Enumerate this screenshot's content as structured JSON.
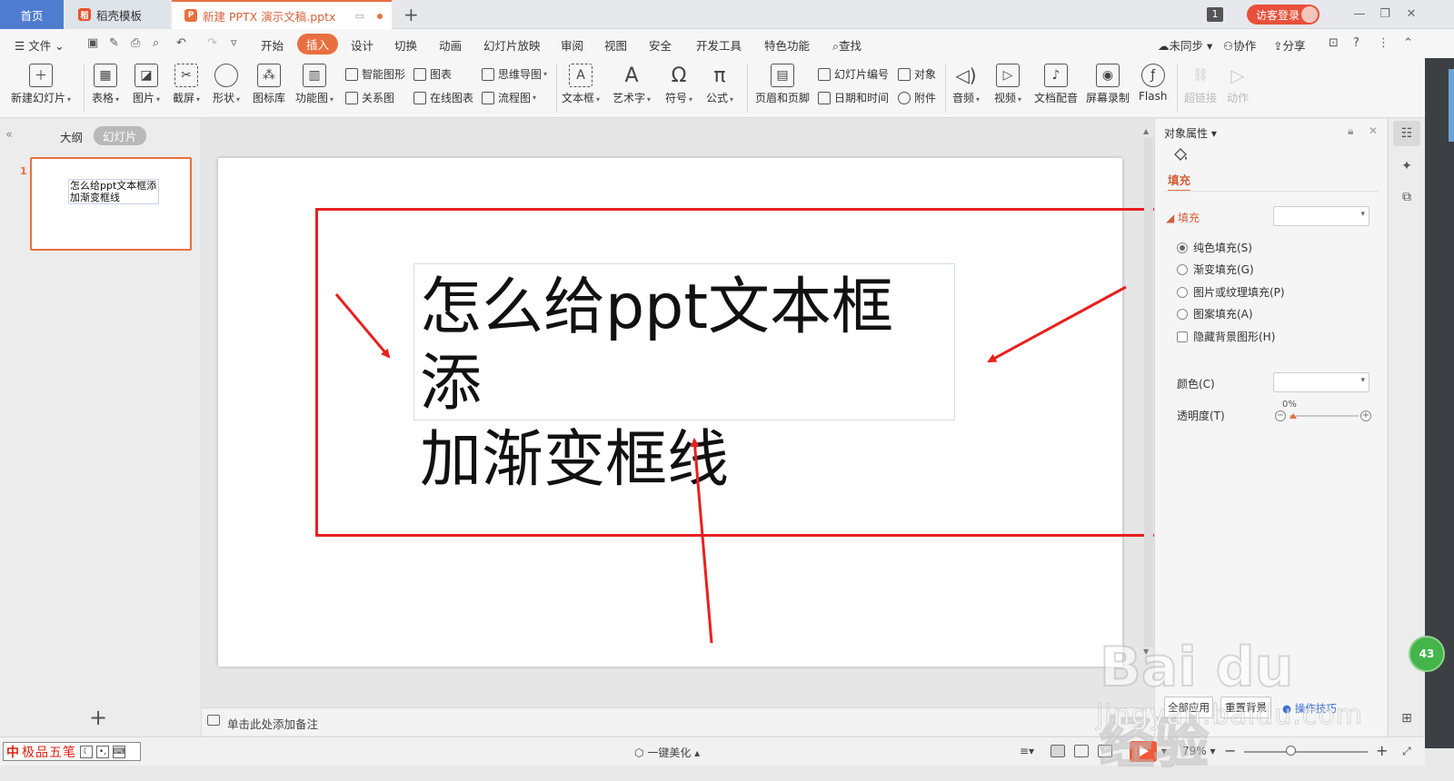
{
  "tabs": {
    "home": "首页",
    "template": "稻壳模板",
    "document": "新建 PPTX 演示文稿.pptx",
    "new_tab": "+"
  },
  "titlebar": {
    "window_count": "1",
    "login": "访客登录"
  },
  "menu": {
    "file": "文件",
    "items": [
      "开始",
      "插入",
      "设计",
      "切换",
      "动画",
      "幻灯片放映",
      "审阅",
      "视图",
      "安全",
      "开发工具",
      "特色功能"
    ],
    "active": "插入",
    "search": "查找",
    "sync": "未同步",
    "collab": "协作",
    "share": "分享"
  },
  "ribbon": {
    "new_slide": "新建幻灯片",
    "table": "表格",
    "picture": "图片",
    "screenshot": "截屏",
    "shape": "形状",
    "icon_lib": "图标库",
    "func_chart": "功能图",
    "smart_art": "智能图形",
    "chart": "图表",
    "mind_map": "思维导图",
    "relation": "关系图",
    "online_chart": "在线图表",
    "flowchart": "流程图",
    "textbox": "文本框",
    "art_text": "艺术字",
    "symbol": "符号",
    "formula": "公式",
    "header_footer": "页眉和页脚",
    "slide_number": "幻灯片编号",
    "object": "对象",
    "date_time": "日期和时间",
    "attachment": "附件",
    "audio": "音频",
    "video": "视频",
    "doc_voice": "文档配音",
    "screen_record": "屏幕录制",
    "flash": "Flash",
    "hyperlink": "超链接",
    "action": "动作"
  },
  "left_panel": {
    "outline_tab": "大纲",
    "slides_tab": "幻灯片",
    "slide_number": "1",
    "thumb_text": "怎么给ppt文本框添加渐变框线"
  },
  "slide": {
    "text_line1": "怎么给ppt文本框添",
    "text_line2": "加渐变框线"
  },
  "notes": {
    "placeholder": "单击此处添加备注"
  },
  "right_panel": {
    "title": "对象属性",
    "fill_tab": "填充",
    "fill_section": "填充",
    "options": [
      "纯色填充(S)",
      "渐变填充(G)",
      "图片或纹理填充(P)",
      "图案填充(A)"
    ],
    "selected_option": "纯色填充(S)",
    "hide_bg": "隐藏背景图形(H)",
    "color_label": "颜色(C)",
    "transparency_label": "透明度(T)",
    "transparency_value": "0%",
    "apply_all": "全部应用",
    "reset": "重置背景",
    "tips": "操作技巧"
  },
  "statusbar": {
    "ime_name": "极品五笔",
    "beautify": "一键美化",
    "zoom": "79%"
  },
  "watermark": {
    "brand": "Bai du 经验",
    "url": "jingyan.baidu.com"
  },
  "side_badge": "43",
  "colors": {
    "accent": "#e87040",
    "home_tab": "#4e7ccf",
    "annotation_red": "#e82020"
  }
}
